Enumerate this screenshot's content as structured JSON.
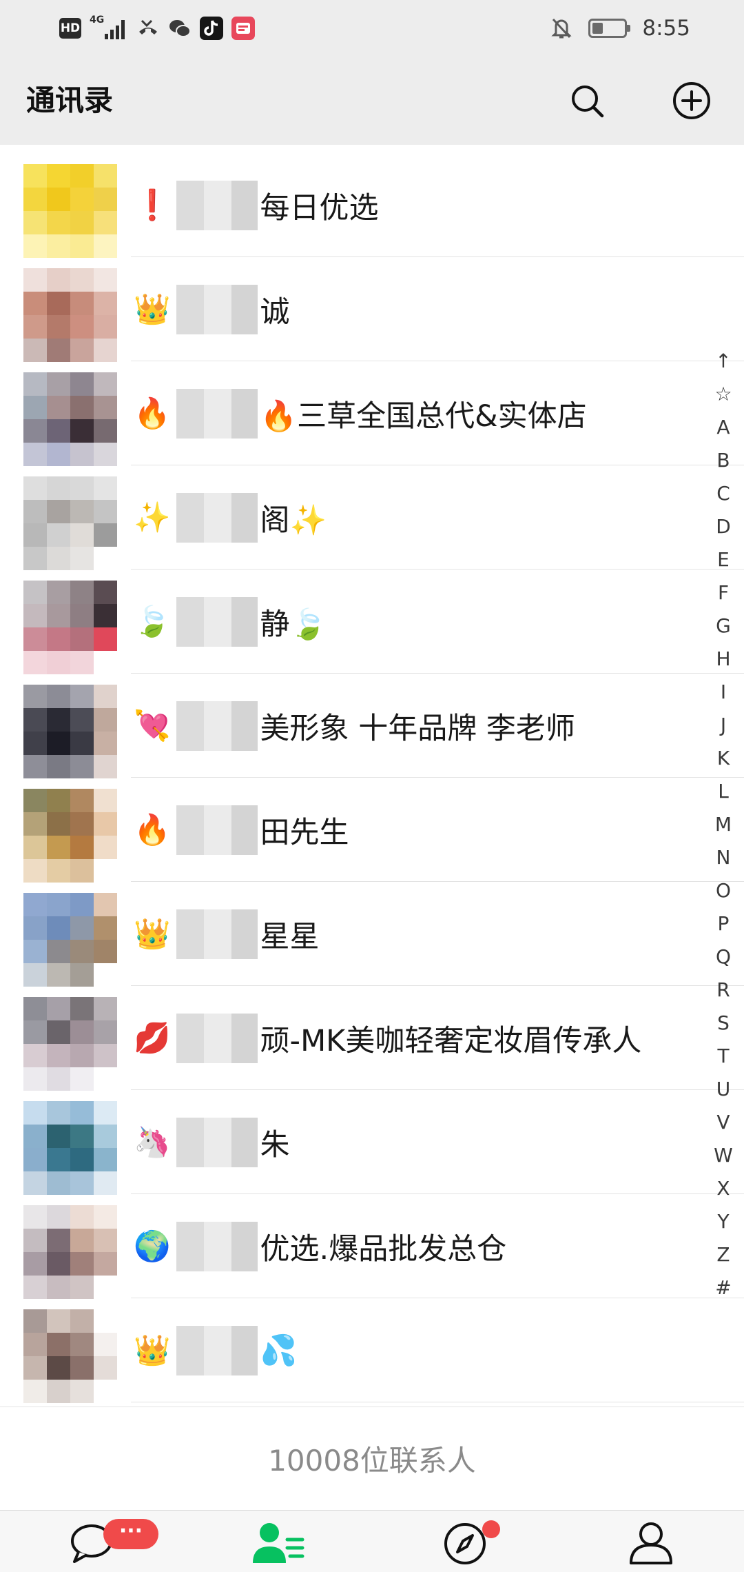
{
  "status_bar": {
    "hd_label": "HD",
    "network_label": "4G",
    "time": "8:55",
    "battery_level": 0.35,
    "icons": [
      "hd-icon",
      "signal-icon",
      "missed-call-icon",
      "wechat-icon",
      "tiktok-icon",
      "app-icon",
      "mute-icon",
      "battery-icon"
    ]
  },
  "header": {
    "title": "通讯录",
    "search_icon": "search-icon",
    "add_icon": "add-circle-icon"
  },
  "contacts": [
    {
      "prefix": "❗",
      "name": "每日优选",
      "colors": [
        "#f7e25c",
        "#f5d632",
        "#f2cf2a",
        "#f6e16a",
        "#f3d63e",
        "#f0c81c",
        "#f4d23a",
        "#efd04a",
        "#f6e374",
        "#f3d64a",
        "#f1d244",
        "#f7e07a",
        "#fdf3b5",
        "#fbeea0",
        "#faeb93",
        "#fdf4c0"
      ]
    },
    {
      "prefix": "👑",
      "name": "诚",
      "colors": [
        "#efe0dc",
        "#e6cfc8",
        "#ead7d0",
        "#f2e6e2",
        "#c98d7a",
        "#a86a5a",
        "#c78c7b",
        "#dcb3a7",
        "#cf9a8a",
        "#b47a6a",
        "#cd8f80",
        "#d9aea3",
        "#cbb9b6",
        "#a07b76",
        "#c9a49c",
        "#e6d4d0"
      ]
    },
    {
      "prefix": "🔥",
      "name": "🔥三草全国总代&实体店",
      "colors": [
        "#b6b9c2",
        "#a8a0a6",
        "#8e8690",
        "#c0b8bc",
        "#9ca6b2",
        "#a68f90",
        "#8a706f",
        "#a89392",
        "#8a8794",
        "#6d6476",
        "#3a2e36",
        "#776a70",
        "#c3c5d6",
        "#b2b6d0",
        "#c6c3cf",
        "#d9d6dc"
      ]
    },
    {
      "prefix": "✨",
      "name": "阁✨",
      "colors": [
        "#dedede",
        "#d6d6d6",
        "#d9d9d9",
        "#e4e4e4",
        "#bdbdbd",
        "#a8a3a0",
        "#bcb8b4",
        "#c4c4c4",
        "#b8b8b8",
        "#d0d0d0",
        "#e0dcd8",
        "#9c9c9c",
        "#c8c8c8",
        "#dcdad8",
        "#e6e4e2",
        "#ffffff"
      ]
    },
    {
      "prefix": "🍃",
      "name": "静🍃",
      "colors": [
        "#c5c2c5",
        "#a89ea2",
        "#8e8286",
        "#5a4c52",
        "#c4b9bd",
        "#a8999d",
        "#8e7e83",
        "#3a2f35",
        "#cc8c98",
        "#c47886",
        "#b4707c",
        "#e0485a",
        "#f3d6dc",
        "#f0cfd6",
        "#f2d5db",
        "#ffffff"
      ]
    },
    {
      "prefix": "💘",
      "name": "美形象 十年品牌 李老师",
      "colors": [
        "#9a9aa2",
        "#8c8c96",
        "#a4a4ae",
        "#e0d2cc",
        "#4a4a54",
        "#2a2a34",
        "#4c4c56",
        "#bfa89c",
        "#40404a",
        "#1c1c26",
        "#3a3a44",
        "#c8b0a4",
        "#8e8e98",
        "#7a7a84",
        "#8c8c96",
        "#e0d4d0"
      ]
    },
    {
      "prefix": "🔥",
      "name": "田先生",
      "colors": [
        "#8a8660",
        "#90804e",
        "#b08860",
        "#f0e0d0",
        "#b4a278",
        "#8c7048",
        "#a0744e",
        "#e8c8a8",
        "#dcc698",
        "#c49a50",
        "#b47a40",
        "#f0dcc8",
        "#eedcc4",
        "#e4cca4",
        "#dcc09c",
        "#ffffff"
      ]
    },
    {
      "prefix": "👑",
      "name": "星星",
      "colors": [
        "#90a8d0",
        "#8aa4cc",
        "#7e9ac6",
        "#e2c6b0",
        "#88a2c8",
        "#6e8cba",
        "#8e98a8",
        "#b0906c",
        "#9ab2d2",
        "#8c8a8e",
        "#9a8a7a",
        "#a08468",
        "#cad2da",
        "#bcb8b2",
        "#a49e96",
        "#ffffff"
      ]
    },
    {
      "prefix": "💋",
      "name": "顽-MK美咖轻奢定妆眉传承人",
      "colors": [
        "#8e8e96",
        "#a6a0a8",
        "#7a7478",
        "#b8b2b6",
        "#9a9aa2",
        "#6a646a",
        "#9c8e96",
        "#a8a2a8",
        "#d8ccd2",
        "#c4b4bc",
        "#b8a8b0",
        "#cec2c8",
        "#eceaee",
        "#e0dce2",
        "#f0eef2",
        "#ffffff"
      ]
    },
    {
      "prefix": "🦄",
      "name": "朱",
      "colors": [
        "#c6dcee",
        "#a8c6dc",
        "#96bcd8",
        "#dceaf4",
        "#8ab0cc",
        "#2c6270",
        "#3c7884",
        "#a8cadc",
        "#8aaecc",
        "#3a7890",
        "#2e6a80",
        "#8ab4cc",
        "#c4d4e2",
        "#9ebcd2",
        "#a8c4da",
        "#e0eaf2"
      ]
    },
    {
      "prefix": "🌍",
      "name": "优选.爆品批发总仓",
      "colors": [
        "#e8e6e8",
        "#dcd8dc",
        "#ecdcd4",
        "#f4eae4",
        "#c4bcc0",
        "#7c6c74",
        "#c8a898",
        "#d8c0b4",
        "#a89ca4",
        "#6a5a64",
        "#a0807a",
        "#c4a8a0",
        "#d8d0d4",
        "#c8bcc0",
        "#d0c4c4",
        "#ffffff"
      ]
    },
    {
      "prefix": "👑",
      "name": "💦",
      "colors": [
        "#a89a96",
        "#d2c4bc",
        "#c2b0a8",
        "#ffffff",
        "#b8a49c",
        "#8c7068",
        "#a08880",
        "#f4f0ee",
        "#c6b6ae",
        "#5c4a46",
        "#8a706a",
        "#e4dcd8",
        "#f0ece8",
        "#d8d0cc",
        "#e6e0dc",
        "#ffffff"
      ]
    }
  ],
  "alpha_index": [
    "↑",
    "☆",
    "A",
    "B",
    "C",
    "D",
    "E",
    "F",
    "G",
    "H",
    "I",
    "J",
    "K",
    "L",
    "M",
    "N",
    "O",
    "P",
    "Q",
    "R",
    "S",
    "T",
    "U",
    "V",
    "W",
    "X",
    "Y",
    "Z",
    "#"
  ],
  "footer": {
    "count_text": "10008位联系人"
  },
  "tab_bar": {
    "active_color": "#07c160",
    "tabs": [
      {
        "icon": "chat-icon",
        "badge": "···"
      },
      {
        "icon": "contacts-icon",
        "badge": ""
      },
      {
        "icon": "compass-icon",
        "badge": ""
      },
      {
        "icon": "profile-icon",
        "badge": ""
      }
    ]
  }
}
